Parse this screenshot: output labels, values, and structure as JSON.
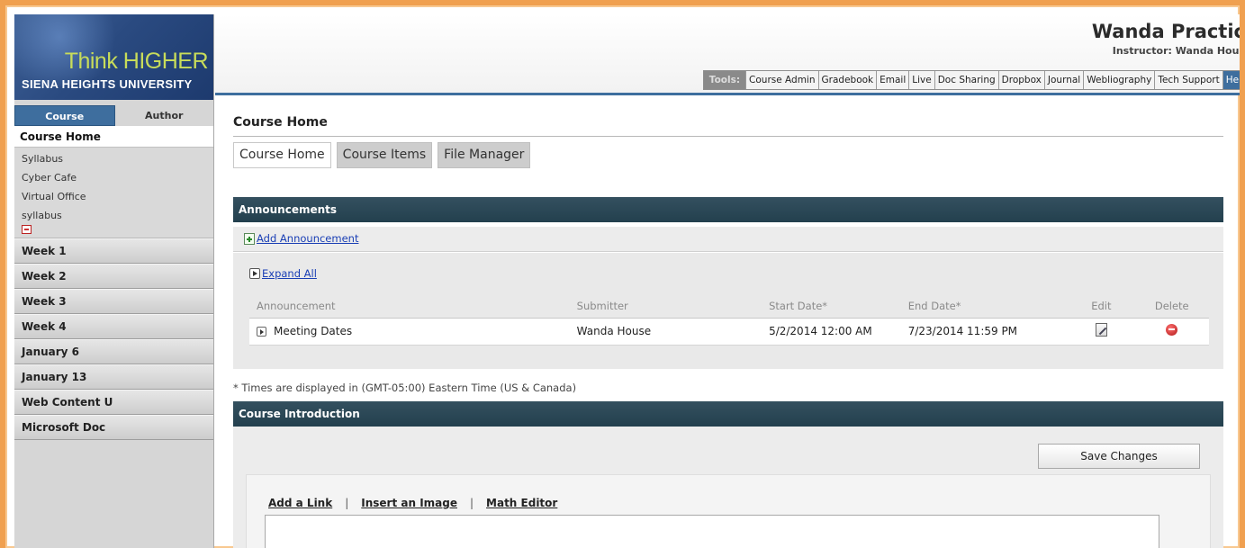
{
  "logo": {
    "tagline": "Think HIGHER",
    "university": "SIENA HEIGHTS UNIVERSITY"
  },
  "sidebar": {
    "mode_tabs": [
      {
        "label": "Course",
        "active": true
      },
      {
        "label": "Author",
        "active": false
      }
    ],
    "current_item": "Course Home",
    "links": [
      "Syllabus",
      "Cyber Cafe",
      "Virtual Office",
      "syllabus"
    ],
    "units": [
      "Week 1",
      "Week 2",
      "Week 3",
      "Week 4",
      "January 6",
      "January 13",
      "Web Content U",
      "Microsoft Doc"
    ]
  },
  "header": {
    "course_title": "Wanda Practic",
    "instructor": "Instructor:  Wanda Hous",
    "tools_label": "Tools:",
    "tools": [
      "Course Admin",
      "Gradebook",
      "Email",
      "Live",
      "Doc Sharing",
      "Dropbox",
      "Journal",
      "Webliography",
      "Tech Support"
    ],
    "help_label": "Hel"
  },
  "main": {
    "page_title": "Course Home",
    "subtabs": [
      {
        "label": "Course Home",
        "active": true
      },
      {
        "label": "Course Items",
        "active": false
      },
      {
        "label": "File Manager",
        "active": false
      }
    ]
  },
  "announcements": {
    "section_title": "Announcements",
    "add_label": "Add Announcement",
    "expand_all_label": "Expand All",
    "columns": [
      "Announcement",
      "Submitter",
      "Start Date*",
      "End Date*",
      "Edit",
      "Delete"
    ],
    "rows": [
      {
        "title": "Meeting Dates",
        "submitter": "Wanda House",
        "start": "5/2/2014 12:00 AM",
        "end": "7/23/2014 11:59 PM"
      }
    ],
    "timezone_note": "* Times are displayed in (GMT-05:00) Eastern Time (US & Canada)"
  },
  "intro": {
    "section_title": "Course Introduction",
    "save_label": "Save Changes",
    "editor_tools": [
      "Add a Link",
      "Insert an Image",
      "Math Editor"
    ],
    "separator": "|"
  },
  "colors": {
    "accent_blue": "#3e6e9e",
    "section_bar": "#2b4654",
    "frame_orange": "#f0a050",
    "logo_green": "#c8dc5a",
    "link_blue": "#1a3fb5"
  }
}
